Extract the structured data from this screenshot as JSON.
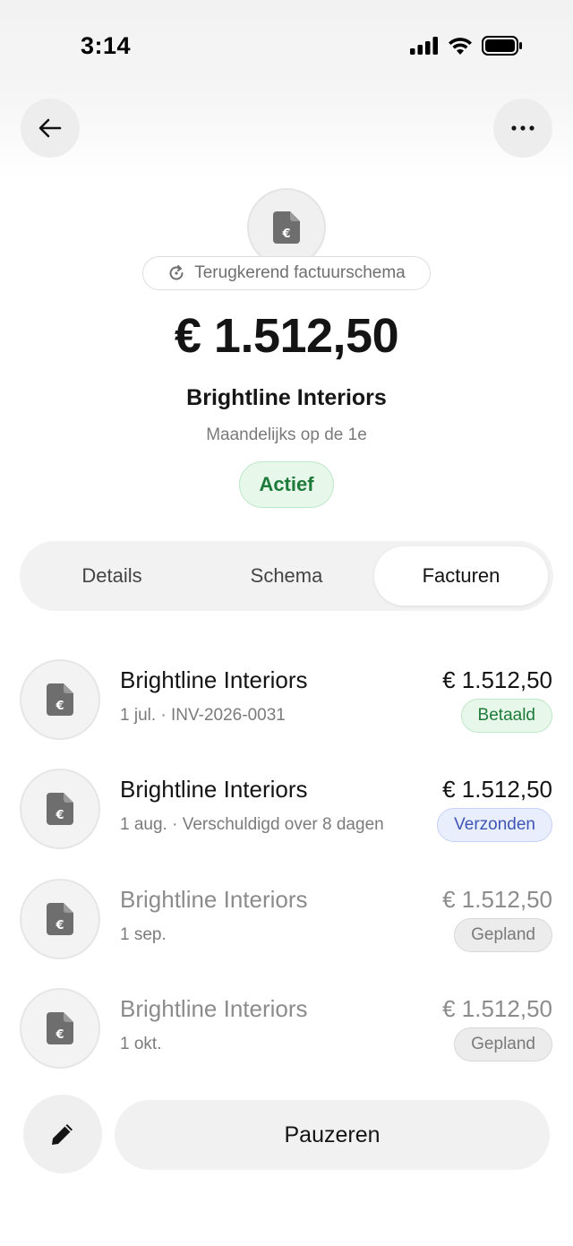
{
  "status_bar": {
    "time": "3:14",
    "icons": [
      "cellular-signal-icon",
      "wifi-icon",
      "battery-icon"
    ]
  },
  "header": {
    "back_icon": "arrow-left-icon",
    "more_icon": "more-horizontal-icon"
  },
  "summary": {
    "doc_icon": "invoice-euro-icon",
    "schedule_label": "Terugkerend factuurschema",
    "schedule_icon": "refresh-icon",
    "amount": "€ 1.512,50",
    "client": "Brightline Interiors",
    "frequency": "Maandelijks op de 1e",
    "status": "Actief"
  },
  "tabs": [
    {
      "label": "Details",
      "active": false
    },
    {
      "label": "Schema",
      "active": false
    },
    {
      "label": "Facturen",
      "active": true
    }
  ],
  "invoices": [
    {
      "name": "Brightline Interiors",
      "meta": "1 jul. · INV-2026-0031",
      "amount": "€ 1.512,50",
      "status": "Betaald",
      "status_type": "paid",
      "muted": false
    },
    {
      "name": "Brightline Interiors",
      "meta": "1 aug. · Verschuldigd over 8 dagen",
      "amount": "€ 1.512,50",
      "status": "Verzonden",
      "status_type": "sent",
      "muted": false
    },
    {
      "name": "Brightline Interiors",
      "meta": "1 sep.",
      "amount": "€ 1.512,50",
      "status": "Gepland",
      "status_type": "planned",
      "muted": true
    },
    {
      "name": "Brightline Interiors",
      "meta": "1 okt.",
      "amount": "€ 1.512,50",
      "status": "Gepland",
      "status_type": "planned",
      "muted": true
    }
  ],
  "actions": {
    "edit_icon": "pencil-icon",
    "pause_label": "Pauzeren"
  },
  "colors": {
    "accent_green": "#1e7a3a",
    "accent_blue": "#3f55b5",
    "neutral_gray": "#7a7a7a"
  }
}
